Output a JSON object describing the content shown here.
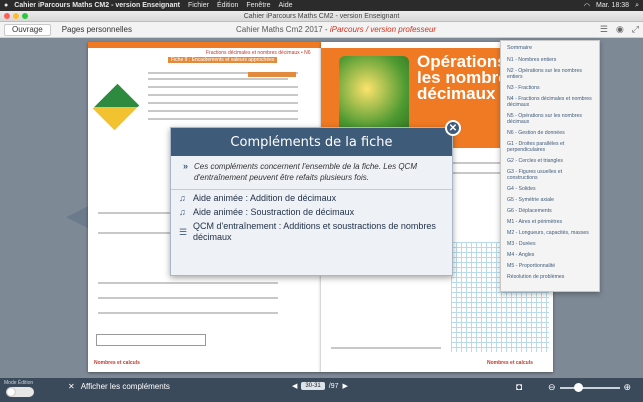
{
  "menubar": {
    "app_name": "Cahier iParcours Maths CM2 - version Enseignant",
    "items": [
      "Fichier",
      "Édition",
      "Fenêtre",
      "Aide"
    ],
    "clock": "Mar. 18:38"
  },
  "window": {
    "title": "Cahier iParcours Maths CM2 - version Enseignant"
  },
  "toolbar": {
    "tabs": [
      {
        "label": "Ouvrage"
      },
      {
        "label": "Pages personnelles"
      }
    ],
    "book_title": "Cahier Maths Cm2 2017 - ",
    "book_subtitle": "iParcours / version professeur"
  },
  "book": {
    "left_header": "Fractions décimales et nombres décimaux • N6",
    "left_section": "Fiche 9 : Encadrements et valeurs approchées",
    "left_footer": "Nombres et calculs",
    "right_title": "Opérations sur les nombres décimaux",
    "right_footer": "Nombres et calculs"
  },
  "modal": {
    "title": "Compléments de la fiche",
    "description": "Ces compléments concernent l'ensemble de la fiche. Les QCM d'entraînement peuvent être refaits plusieurs fois.",
    "items": [
      {
        "label": "Aide animée : Addition de décimaux",
        "icon": "headphones-icon"
      },
      {
        "label": "Aide animée : Soustraction de décimaux",
        "icon": "headphones-icon"
      },
      {
        "label": "QCM d'entraînement : Additions et soustractions de nombres décimaux",
        "icon": "list-icon"
      }
    ]
  },
  "sommaire": {
    "title": "Sommaire",
    "items": [
      "N1 - Nombres entiers",
      "N2 - Opérations sur les nombres entiers",
      "N3 - Fractions",
      "N4 - Fractions décimales et nombres décimaux",
      "N5 - Opérations sur les nombres décimaux",
      "N6 - Gestion de données",
      "G1 - Droites parallèles et perpendiculaires",
      "G2 - Cercles et triangles",
      "G3 - Figures usuelles et constructions",
      "G4 - Solides",
      "G5 - Symétrie axiale",
      "G6 - Déplacements",
      "M1 - Aires et périmètres",
      "M2 - Longueurs, capacités, masses",
      "M3 - Durées",
      "M4 - Angles",
      "M5 - Proportionnalité",
      "Résolution de problèmes"
    ]
  },
  "bottombar": {
    "mode_label": "Mode Édition",
    "show_complements": "Afficher les compléments",
    "page_value": "30-31",
    "page_total": "/97"
  }
}
